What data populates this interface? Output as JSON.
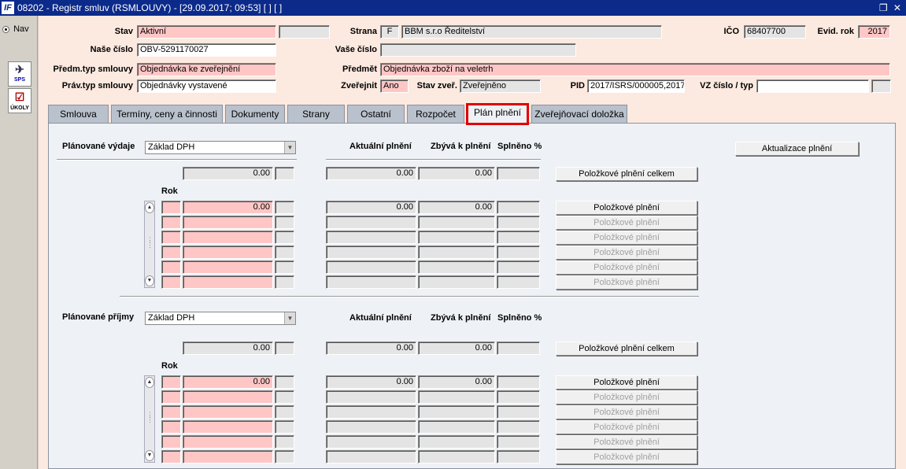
{
  "window": {
    "title": "08202 - Registr smluv (RSMLOUVY) - [29.09.2017; 09:53]  [ ]  [ ]",
    "logo_text": "IF",
    "controls": "❐ ✕"
  },
  "left_panel": {
    "nav_label": "Nav",
    "sps_label": "SPS",
    "ukoly_label": "ÚKOLY"
  },
  "header": {
    "stav_label": "Stav",
    "stav_value": "Aktivní",
    "strana_label": "Strana",
    "strana_code": "F",
    "strana_value": "BBM s.r.o Ředitelství",
    "ico_label": "IČO",
    "ico_value": "68407700",
    "evid_rok_label": "Evid. rok",
    "evid_rok_value": "2017",
    "nase_cislo_label": "Naše číslo",
    "nase_cislo_value": "OBV-5291170027",
    "vase_cislo_label": "Vaše číslo",
    "vase_cislo_value": "",
    "predm_typ_label": "Předm.typ smlouvy",
    "predm_typ_value": "Objednávka ke zveřejnění",
    "predmet_label": "Předmět",
    "predmet_value": "Objednávka zboží na veletrh",
    "prav_typ_label": "Práv.typ smlouvy",
    "prav_typ_value": "Objednávky vystavené",
    "zverejnit_label": "Zveřejnit",
    "zverejnit_value": "Ano",
    "stav_zver_label": "Stav zveř.",
    "stav_zver_value": "Zveřejněno",
    "pid_label": "PID",
    "pid_value": "2017/ISRS/000005,2017/",
    "vz_label": "VZ číslo / typ",
    "vz_value": ""
  },
  "tabs": [
    {
      "label": "Smlouva"
    },
    {
      "label": "Termíny, ceny a činnosti"
    },
    {
      "label": "Dokumenty"
    },
    {
      "label": "Strany"
    },
    {
      "label": "Ostatní"
    },
    {
      "label": "Rozpočet"
    },
    {
      "label": "Plán plnění"
    },
    {
      "label": "Zveřejňovací doložka"
    }
  ],
  "active_tab": "Plán plnění",
  "panel": {
    "update_button": "Aktualizace plnění",
    "expenses": {
      "label": "Plánované výdaje",
      "combo_value": "Základ DPH",
      "col_actual": "Aktuální plnění",
      "col_remaining": "Zbývá k plnění",
      "col_percent": "Splněno %",
      "total_value": "0.00",
      "total_actual": "0.00",
      "total_remaining": "0.00",
      "total_button": "Položkové plnění celkem",
      "year_label": "Rok",
      "row_button": "Položkové plnění",
      "rows": [
        {
          "value": "0.00",
          "actual": "0.00",
          "remaining": "0.00"
        },
        {
          "value": "",
          "actual": "",
          "remaining": ""
        },
        {
          "value": "",
          "actual": "",
          "remaining": ""
        },
        {
          "value": "",
          "actual": "",
          "remaining": ""
        },
        {
          "value": "",
          "actual": "",
          "remaining": ""
        },
        {
          "value": "",
          "actual": "",
          "remaining": ""
        }
      ]
    },
    "income": {
      "label": "Plánované příjmy",
      "combo_value": "Základ DPH",
      "col_actual": "Aktuální plnění",
      "col_remaining": "Zbývá k plnění",
      "col_percent": "Splněno %",
      "total_value": "0.00",
      "total_actual": "0.00",
      "total_remaining": "0.00",
      "total_button": "Položkové plnění celkem",
      "year_label": "Rok",
      "row_button": "Položkové plnění",
      "rows": [
        {
          "value": "0.00",
          "actual": "0.00",
          "remaining": "0.00"
        },
        {
          "value": "",
          "actual": "",
          "remaining": ""
        },
        {
          "value": "",
          "actual": "",
          "remaining": ""
        },
        {
          "value": "",
          "actual": "",
          "remaining": ""
        },
        {
          "value": "",
          "actual": "",
          "remaining": ""
        },
        {
          "value": "",
          "actual": "",
          "remaining": ""
        }
      ]
    }
  }
}
